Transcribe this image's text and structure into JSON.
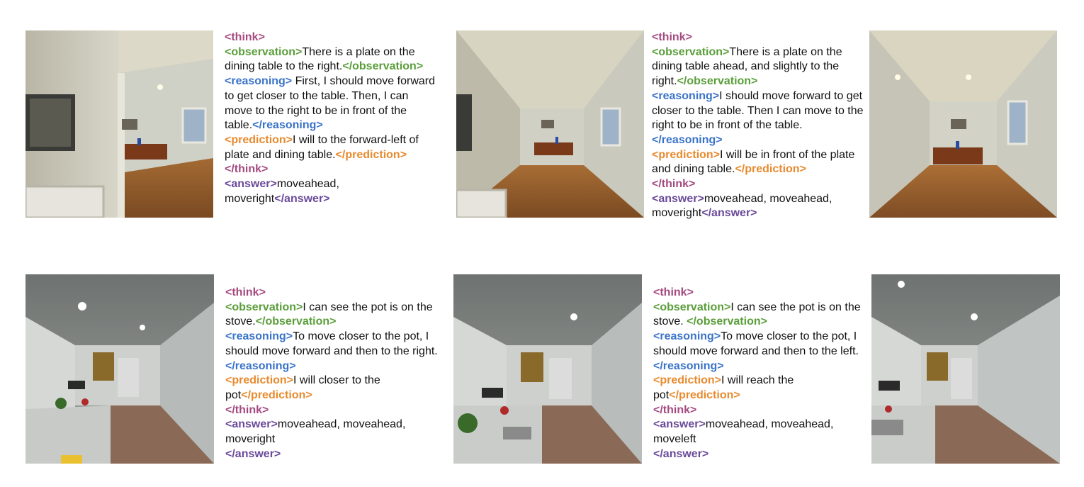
{
  "colors": {
    "think": "#a54a80",
    "observation": "#5a9e3a",
    "reasoning": "#3a73c9",
    "prediction": "#e88a2e",
    "answer": "#6a4a9a"
  },
  "panels": [
    {
      "lines": [
        [
          {
            "k": "think",
            "t": "<think>"
          }
        ],
        [
          {
            "k": "obs",
            "t": "<observation>"
          },
          {
            "t": "There is a plate on the dining table to the right."
          },
          {
            "k": "obs",
            "t": "</observation>"
          }
        ],
        [
          {
            "k": "reas",
            "t": "<reasoning>"
          },
          {
            "t": " First, I should move forward to get closer to the table. Then, I can move to the right to be in front of the table."
          },
          {
            "k": "reas",
            "t": "</reasoning>"
          }
        ],
        [
          {
            "k": "pred",
            "t": "<prediction>"
          },
          {
            "t": "I will to the forward-left of plate and dining table."
          },
          {
            "k": "pred",
            "t": "</prediction>"
          }
        ],
        [
          {
            "k": "think",
            "t": "</think>"
          }
        ],
        [
          {
            "k": "ans",
            "t": "<answer>"
          },
          {
            "t": "moveahead, moveright"
          },
          {
            "k": "ans",
            "t": "</answer>"
          }
        ]
      ]
    },
    {
      "lines": [
        [
          {
            "k": "think",
            "t": "<think>"
          }
        ],
        [
          {
            "k": "obs",
            "t": "<observation>"
          },
          {
            "t": "There is a plate on the dining table ahead, and slightly to the right."
          },
          {
            "k": "obs",
            "t": "</observation>"
          }
        ],
        [
          {
            "k": "reas",
            "t": "<reasoning>"
          },
          {
            "t": "I should move forward to get closer to the table. Then I can move to the right to be in front of the table."
          },
          {
            "k": "reas",
            "t": "</reasoning>"
          }
        ],
        [
          {
            "k": "pred",
            "t": "<prediction>"
          },
          {
            "t": "I will be in front of the plate and dining table."
          },
          {
            "k": "pred",
            "t": "</prediction>"
          }
        ],
        [
          {
            "k": "think",
            "t": "</think>"
          }
        ],
        [
          {
            "k": "ans",
            "t": "<answer>"
          },
          {
            "t": "moveahead, moveahead, moveright"
          },
          {
            "k": "ans",
            "t": "</answer>"
          }
        ]
      ]
    },
    {
      "lines": [
        [
          {
            "k": "think",
            "t": "<think>"
          }
        ],
        [
          {
            "k": "obs",
            "t": "<observation>"
          },
          {
            "t": "I can see the pot is on the stove."
          },
          {
            "k": "obs",
            "t": "</observation>"
          }
        ],
        [
          {
            "k": "reas",
            "t": "<reasoning>"
          },
          {
            "t": "To move closer to the pot, I should move forward and then to the right."
          },
          {
            "k": "reas",
            "t": "</reasoning>"
          }
        ],
        [
          {
            "k": "pred",
            "t": "<prediction>"
          },
          {
            "t": "I will closer to the pot"
          },
          {
            "k": "pred",
            "t": "</prediction>"
          }
        ],
        [
          {
            "k": "think",
            "t": "</think>"
          }
        ],
        [
          {
            "k": "ans",
            "t": "<answer>"
          },
          {
            "t": "moveahead, moveahead, moveright"
          }
        ],
        [
          {
            "k": "ans",
            "t": "</answer>"
          }
        ]
      ]
    },
    {
      "lines": [
        [
          {
            "k": "think",
            "t": "<think>"
          }
        ],
        [
          {
            "k": "obs",
            "t": "<observation>"
          },
          {
            "t": "I can see the pot is on the stove. "
          },
          {
            "k": "obs",
            "t": "</observation>"
          }
        ],
        [
          {
            "k": "reas",
            "t": "<reasoning>"
          },
          {
            "t": "To move closer to the pot, I should move forward and then to the left."
          },
          {
            "k": "reas",
            "t": "</reasoning>"
          }
        ],
        [
          {
            "k": "pred",
            "t": "<prediction>"
          },
          {
            "t": "I will reach the pot"
          },
          {
            "k": "pred",
            "t": "</prediction>"
          }
        ],
        [
          {
            "k": "think",
            "t": "</think>"
          }
        ],
        [
          {
            "k": "ans",
            "t": "<answer>"
          },
          {
            "t": "moveahead, moveahead, moveleft"
          }
        ],
        [
          {
            "k": "ans",
            "t": "</answer>"
          }
        ]
      ]
    }
  ]
}
